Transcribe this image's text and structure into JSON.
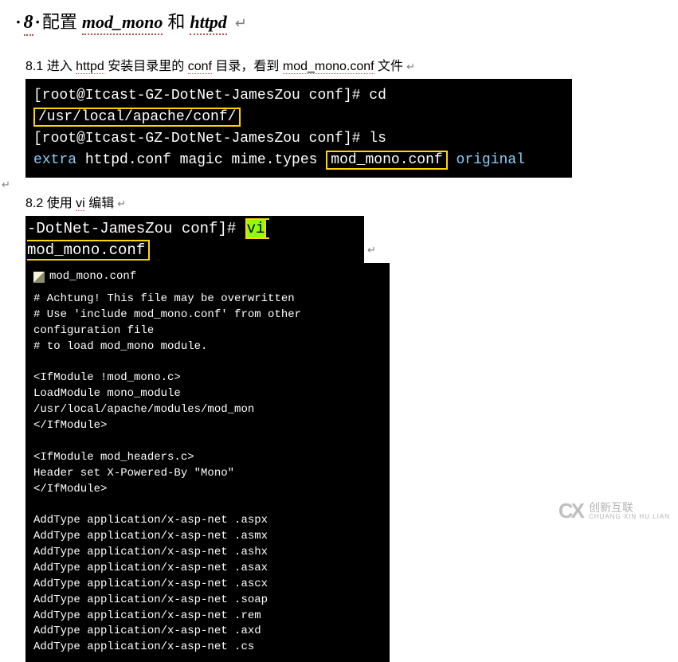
{
  "heading": {
    "number": "8",
    "prefix_text": "配置",
    "mod_term": "mod_mono",
    "and_text": "和",
    "httpd_term": "httpd",
    "arrow": "↵"
  },
  "step1": {
    "number": "8.1",
    "t1": "进入",
    "httpd": "httpd",
    "t2": "安装目录里的",
    "conf": "conf",
    "t3": "目录，看到",
    "modconf": "mod_mono.conf",
    "t4": "文件",
    "arrow": "↵"
  },
  "terminal1": {
    "line1_prompt": "[root@Itcast-GZ-DotNet-JamesZou conf]# cd ",
    "line1_boxed": "/usr/local/apache/conf/",
    "line2_prompt": "[root@Itcast-GZ-DotNet-JamesZou conf]# ls",
    "line3_extra": "extra",
    "line3_files": "  httpd.conf  magic  mime.types  ",
    "line3_boxed": "mod_mono.conf",
    "line3_original": "  original"
  },
  "step2": {
    "number": "8.2",
    "t1": "使用",
    "vi": "vi",
    "t2": "编辑",
    "arrow": "↵"
  },
  "terminal2": {
    "prompt": "-DotNet-JamesZou conf]# ",
    "cmd_vi": "vi",
    "cmd_arg": " mod_mono.conf"
  },
  "editor": {
    "title": "mod_mono.conf",
    "lines": [
      "",
      "# Achtung! This file may be overwritten",
      "# Use 'include mod_mono.conf' from other configuration file",
      "# to load mod_mono module.",
      "",
      "<IfModule !mod_mono.c>",
      "    LoadModule mono_module /usr/local/apache/modules/mod_mon",
      "</IfModule>",
      "",
      "<IfModule mod_headers.c>",
      "    Header set X-Powered-By \"Mono\"",
      "</IfModule>",
      "",
      "AddType application/x-asp-net .aspx",
      "AddType application/x-asp-net .asmx",
      "AddType application/x-asp-net .ashx",
      "AddType application/x-asp-net .asax",
      "AddType application/x-asp-net .ascx",
      "AddType application/x-asp-net .soap",
      "AddType application/x-asp-net .rem",
      "AddType application/x-asp-net .axd",
      "AddType application/x-asp-net .cs"
    ]
  },
  "watermark": {
    "cn": "创新互联",
    "en": "CHUANG XIN HU LIAN"
  }
}
